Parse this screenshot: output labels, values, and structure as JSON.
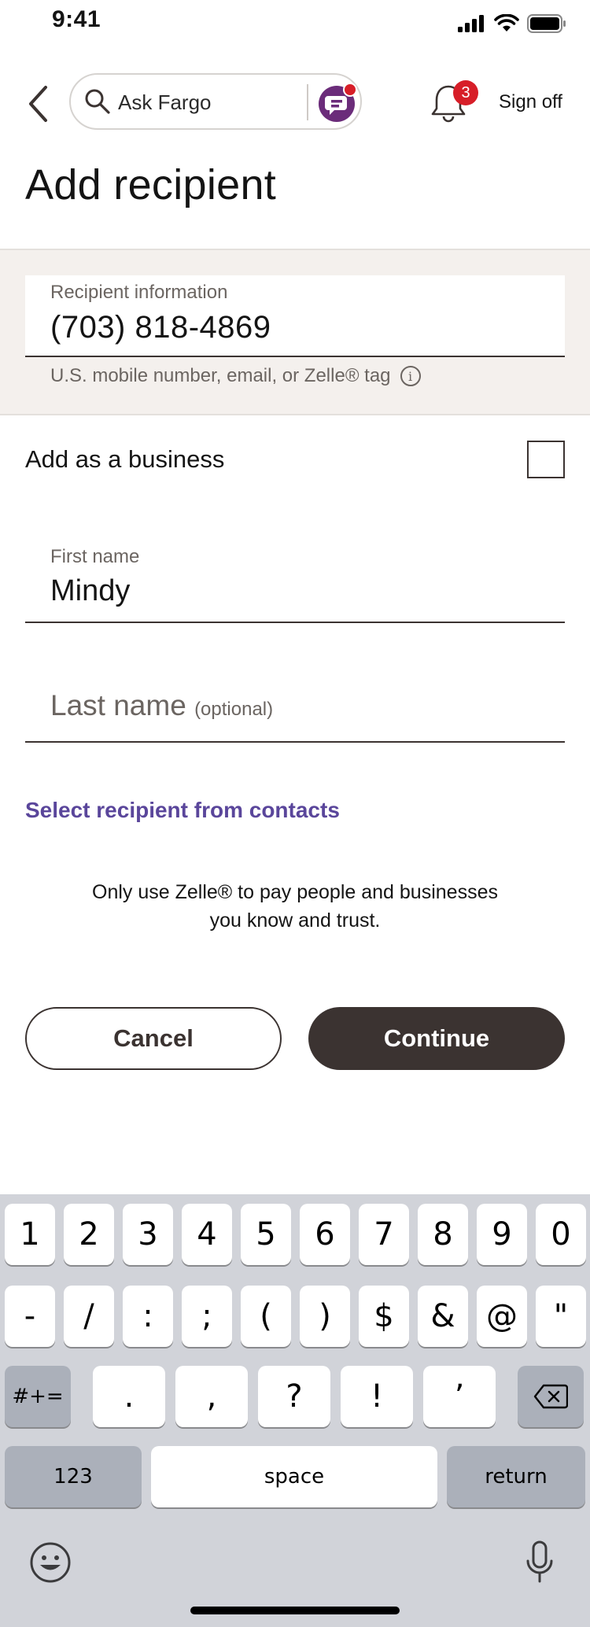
{
  "status_bar": {
    "time": "9:41"
  },
  "header": {
    "search_placeholder": "Ask Fargo",
    "notification_count": "3",
    "sign_off_label": "Sign off"
  },
  "page_title": "Add recipient",
  "recipient": {
    "label": "Recipient information",
    "value": "(703) 818-4869",
    "help_text": "U.S. mobile number, email, or Zelle® tag"
  },
  "business": {
    "label": "Add as a business",
    "checked": false
  },
  "first_name": {
    "label": "First name",
    "value": "Mindy"
  },
  "last_name": {
    "label": "Last name",
    "optional": "(optional)"
  },
  "contacts_link": "Select recipient from contacts",
  "disclaimer": {
    "line1": "Only use Zelle® to pay people and businesses",
    "line2": "you know and trust."
  },
  "buttons": {
    "cancel": "Cancel",
    "continue": "Continue"
  },
  "keyboard": {
    "row1": [
      "1",
      "2",
      "3",
      "4",
      "5",
      "6",
      "7",
      "8",
      "9",
      "0"
    ],
    "row2": [
      "-",
      "/",
      ":",
      ";",
      "(",
      ")",
      "$",
      "&",
      "@",
      "\""
    ],
    "row3_mode": "#+=",
    "row3": [
      ".",
      ",",
      "?",
      "!",
      "’"
    ],
    "mode_123": "123",
    "space": "space",
    "return": "return"
  },
  "colors": {
    "brand_purple": "#5a469b",
    "dark_button": "#3b3331",
    "badge_red": "#d71e28",
    "band_bg": "#f4f0ed",
    "keyboard_bg": "#d1d3d9"
  }
}
